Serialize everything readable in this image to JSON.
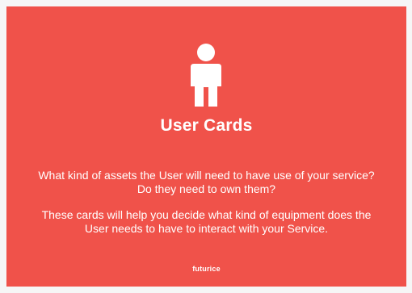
{
  "card": {
    "background_color": "#f0524a",
    "icon": "person-icon",
    "title": "User Cards",
    "paragraph_1": "What kind of assets the User will need to have use of your service? Do they need to own them?",
    "paragraph_2": "These cards will help you decide what kind of equipment does the User needs to have to interact with your Service.",
    "brand": "futurice"
  }
}
